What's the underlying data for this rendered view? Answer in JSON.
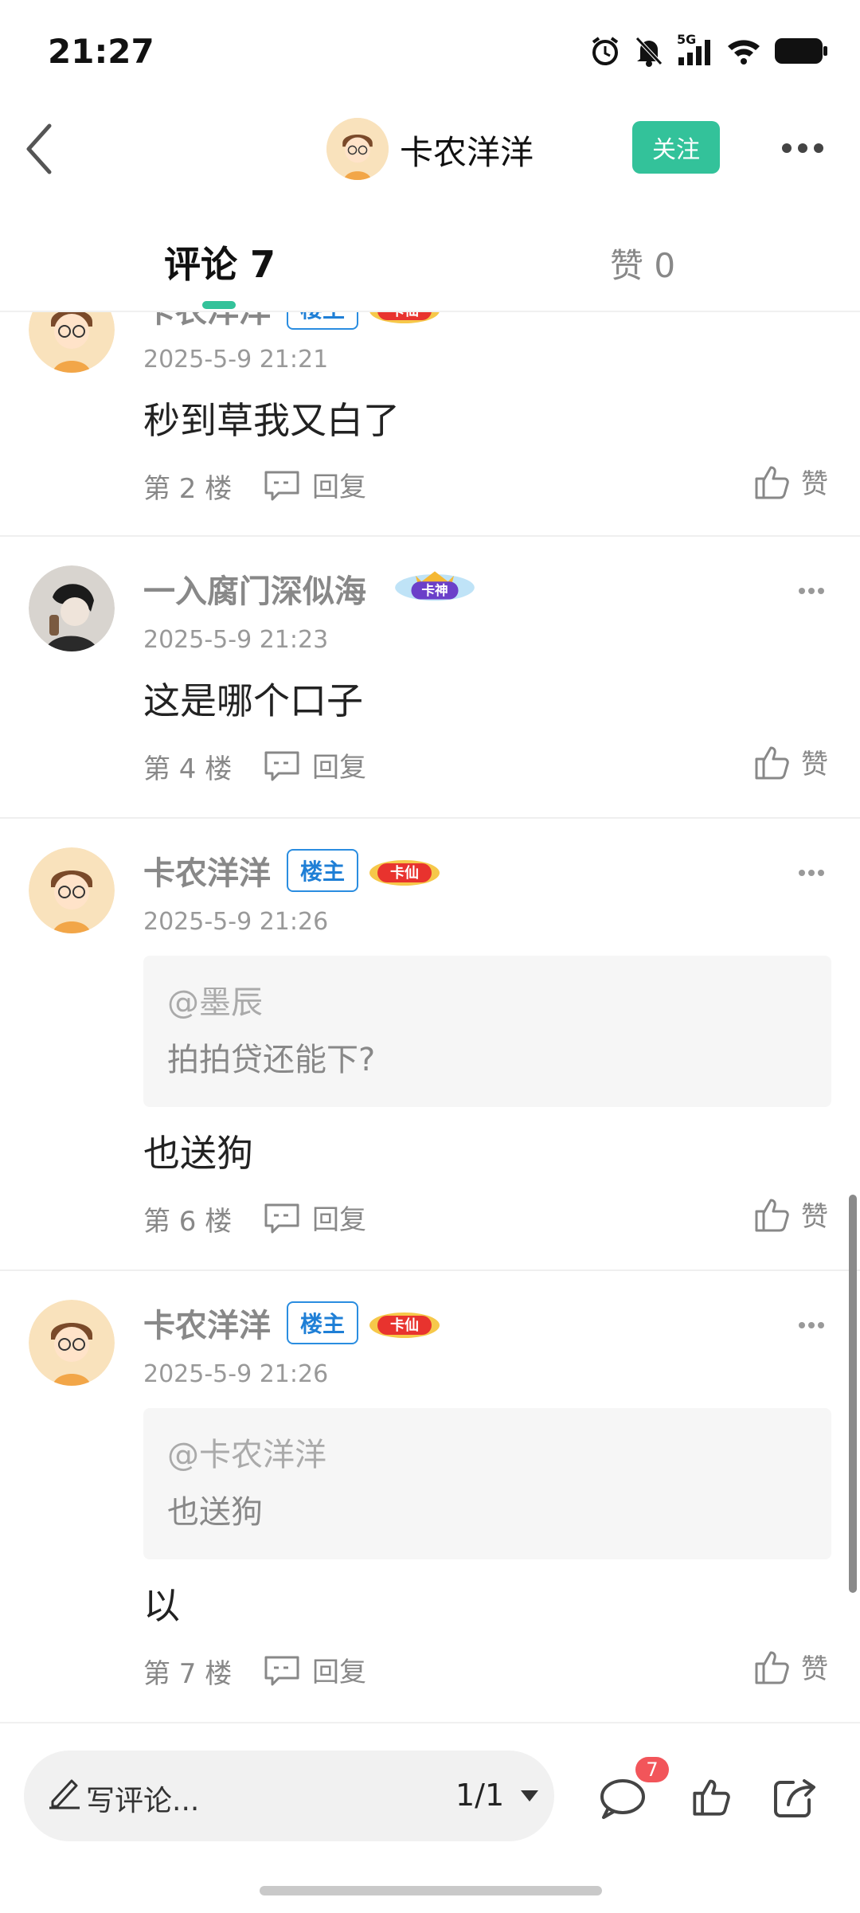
{
  "status": {
    "time": "21:27",
    "network": "5G"
  },
  "header": {
    "name": "卡农洋洋",
    "follow_label": "关注"
  },
  "tabs": {
    "comments": "评论 7",
    "likes": "赞 0"
  },
  "comments": [
    {
      "name": "卡农洋洋",
      "badge": "楼主",
      "rank": "卡仙",
      "time": "2025-5-9 21:21",
      "text": "秒到草我又白了",
      "floor": "第 2 楼",
      "reply": "回复",
      "like": "赞"
    },
    {
      "name": "一入腐门深似海",
      "rank": "卡神",
      "time": "2025-5-9 21:23",
      "text": "这是哪个口子",
      "floor": "第 4 楼",
      "reply": "回复",
      "like": "赞"
    },
    {
      "name": "卡农洋洋",
      "badge": "楼主",
      "rank": "卡仙",
      "time": "2025-5-9 21:26",
      "quote_at": "@墨辰",
      "quote_text": "拍拍贷还能下?",
      "text": "也送狗",
      "floor": "第 6 楼",
      "reply": "回复",
      "like": "赞"
    },
    {
      "name": "卡农洋洋",
      "badge": "楼主",
      "rank": "卡仙",
      "time": "2025-5-9 21:26",
      "quote_at": "@卡农洋洋",
      "quote_text": "也送狗",
      "text": "以",
      "floor": "第 7 楼",
      "reply": "回复",
      "like": "赞"
    }
  ],
  "bottom": {
    "placeholder": "写评论...",
    "page": "1/1",
    "comment_count": "7"
  },
  "colors": {
    "accent": "#33c29a",
    "host_badge": "#2a8de0",
    "badge_red": "#f2555a"
  }
}
